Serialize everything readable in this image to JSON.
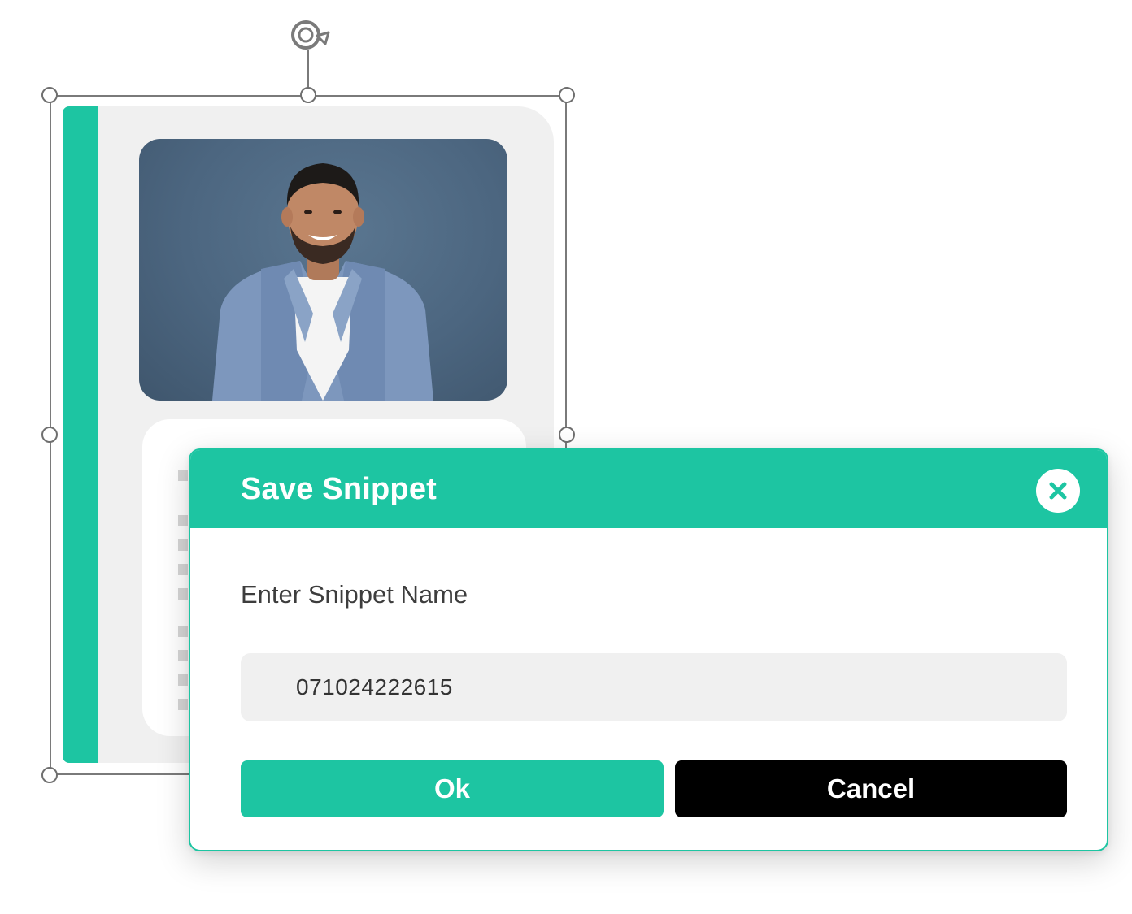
{
  "dialog": {
    "title": "Save Snippet",
    "close_icon": "close-icon",
    "field_label": "Enter Snippet Name",
    "input_value": "071024222615",
    "ok_label": "Ok",
    "cancel_label": "Cancel"
  },
  "canvas": {
    "rotate_icon": "rotate-icon",
    "photo": "portrait-photo"
  },
  "colors": {
    "accent": "#1dc5a2",
    "cancel": "#000000",
    "card": "#f0f0f0",
    "input_bg": "#f0f0f0"
  }
}
